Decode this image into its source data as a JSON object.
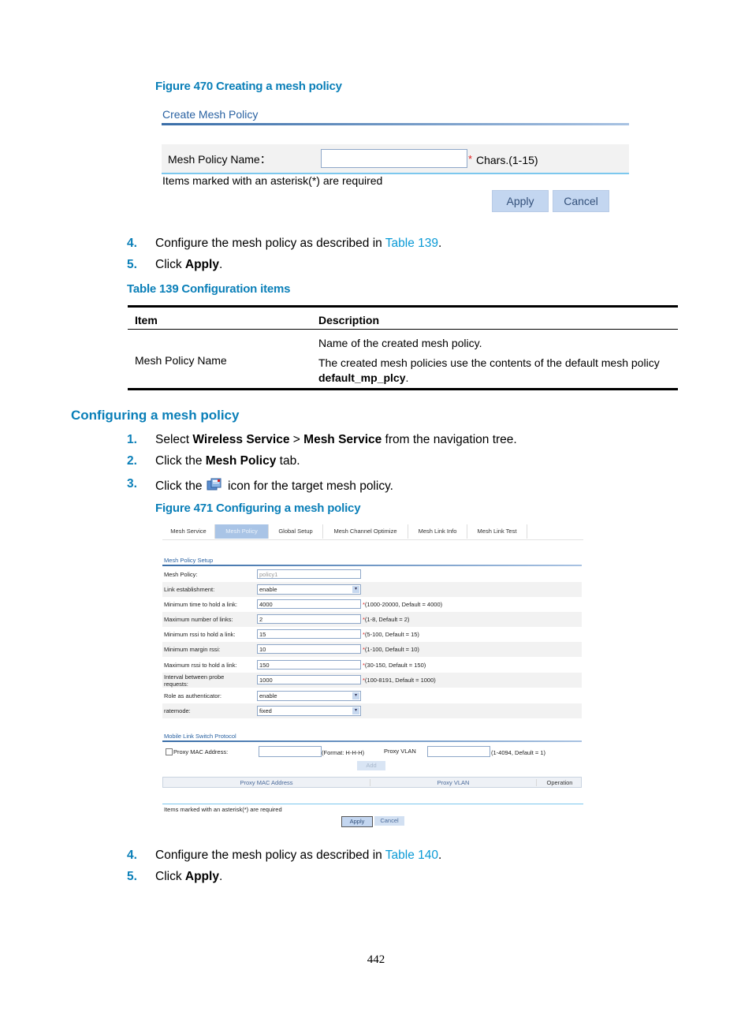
{
  "figure470": {
    "caption": "Figure 470 Creating a mesh policy",
    "panel_title": "Create Mesh Policy",
    "field_label": "Mesh Policy Name：",
    "field_value": "",
    "required_mark": "*",
    "field_hint": "Chars.(1-15)",
    "required_note": "Items marked with an asterisk(*) are required",
    "apply_label": "Apply",
    "cancel_label": "Cancel"
  },
  "steps_a": [
    {
      "num": "4.",
      "pre": "Configure the mesh policy as described in ",
      "link": "Table 139",
      "post": "."
    },
    {
      "num": "5.",
      "pre": "Click ",
      "bold": "Apply",
      "post": "."
    }
  ],
  "table139": {
    "caption": "Table 139 Configuration items",
    "headers": [
      "Item",
      "Description"
    ],
    "rows": [
      {
        "item": "Mesh Policy Name",
        "desc1": "Name of the created mesh policy.",
        "desc2": "The created mesh policies use the contents of the default mesh policy",
        "desc2_bold": "default_mp_plcy",
        "desc2_end": "."
      }
    ]
  },
  "section_heading": "Configuring a mesh policy",
  "steps_b": [
    {
      "num": "1.",
      "pre": "Select ",
      "bold1": "Wireless Service",
      "mid": " > ",
      "bold2": "Mesh Service",
      "post": " from the navigation tree."
    },
    {
      "num": "2.",
      "pre": "Click the ",
      "bold1": "Mesh Policy",
      "post": " tab."
    },
    {
      "num": "3.",
      "pre": "Click the ",
      "icon": "edit-policy-icon",
      "post": " icon for the target mesh policy."
    }
  ],
  "figure471": {
    "caption": "Figure 471 Configuring a mesh policy",
    "tabs": [
      "Mesh Service",
      "Mesh Policy",
      "Global Setup",
      "Mesh Channel Optimize",
      "Mesh Link Info",
      "Mesh Link Test"
    ],
    "active_tab": "Mesh Policy",
    "setup_title": "Mesh Policy Setup",
    "fields": [
      {
        "label": "Mesh Policy:",
        "type": "text",
        "value": "policy1",
        "disabled": true,
        "hint": ""
      },
      {
        "label": "Link establishment:",
        "type": "select",
        "value": "enable",
        "hint": ""
      },
      {
        "label": "Minimum time to hold a link:",
        "type": "text",
        "value": "4000",
        "hint": "(1000-20000, Default = 4000)"
      },
      {
        "label": "Maximum number of links:",
        "type": "text",
        "value": "2",
        "hint": "(1-8, Default = 2)"
      },
      {
        "label": "Minimum rssi to hold a link:",
        "type": "text",
        "value": "15",
        "hint": "(5-100, Default = 15)"
      },
      {
        "label": "Minimum margin rssi:",
        "type": "text",
        "value": "10",
        "hint": "(1-100, Default = 10)"
      },
      {
        "label": "Maximum rssi to hold a link:",
        "type": "text",
        "value": "150",
        "hint": "(30-150, Default = 150)"
      },
      {
        "label": "Interval between probe requests:",
        "type": "text",
        "value": "1000",
        "hint": "(100-8191, Default = 1000)"
      },
      {
        "label": "Role as authenticator:",
        "type": "select",
        "value": "enable",
        "hint": ""
      },
      {
        "label": "ratemode:",
        "type": "select",
        "value": "fixed",
        "hint": ""
      }
    ],
    "mlsp_title": "Mobile Link Switch Protocol",
    "proxy_mac_label": "Proxy MAC Address:",
    "proxy_mac_value": "",
    "proxy_mac_hint": "(Format: H-H-H)",
    "proxy_vlan_label": "Proxy VLAN",
    "proxy_vlan_value": "",
    "proxy_vlan_hint": "(1-4094, Default = 1)",
    "add_label": "Add",
    "table_headers": [
      "Proxy MAC Address",
      "Proxy VLAN",
      "Operation"
    ],
    "required_note": "Items marked with an asterisk(*) are required",
    "apply_label": "Apply",
    "cancel_label": "Cancel"
  },
  "steps_c": [
    {
      "num": "4.",
      "pre": "Configure the mesh policy as described in ",
      "link": "Table 140",
      "post": "."
    },
    {
      "num": "5.",
      "pre": "Click ",
      "bold": "Apply",
      "post": "."
    }
  ],
  "page_number": "442"
}
